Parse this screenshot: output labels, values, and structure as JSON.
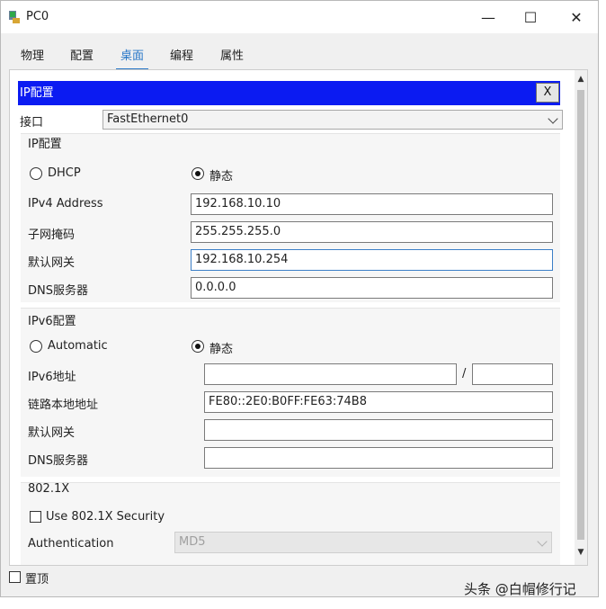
{
  "window": {
    "title": "PC0",
    "min": "—",
    "max": "☐",
    "close": "✕"
  },
  "tabs": [
    {
      "label": "物理"
    },
    {
      "label": "配置"
    },
    {
      "label": "桌面"
    },
    {
      "label": "编程"
    },
    {
      "label": "属性"
    }
  ],
  "ip_panel": {
    "title": "IP配置",
    "close": "X",
    "interface_label": "接口",
    "interface_value": "FastEthernet0",
    "ipv4_group": {
      "title": "IP配置",
      "dhcp_label": "DHCP",
      "static_label": "静态",
      "mode": "static",
      "ipv4_label": "IPv4 Address",
      "ipv4_value": "192.168.10.10",
      "mask_label": "子网掩码",
      "mask_value": "255.255.255.0",
      "gateway_label": "默认网关",
      "gateway_value": "192.168.10.254",
      "dns_label": "DNS服务器",
      "dns_value": "0.0.0.0"
    },
    "ipv6_group": {
      "title": "IPv6配置",
      "auto_label": "Automatic",
      "static_label": "静态",
      "mode": "static",
      "addr_label": "IPv6地址",
      "addr_value": "",
      "slash": "/",
      "prefix_value": "",
      "link_local_label": "链路本地地址",
      "link_local_value": "FE80::2E0:B0FF:FE63:74B8",
      "gateway_label": "默认网关",
      "gateway_value": "",
      "dns_label": "DNS服务器",
      "dns_value": ""
    },
    "dot1x_group": {
      "title": "802.1X",
      "use_label": "Use 802.1X Security",
      "use_checked": false,
      "auth_label": "Authentication",
      "auth_value": "MD5"
    }
  },
  "top_checkbox": {
    "label": "置顶",
    "checked": false
  },
  "watermark": "头条 @白帽修行记"
}
